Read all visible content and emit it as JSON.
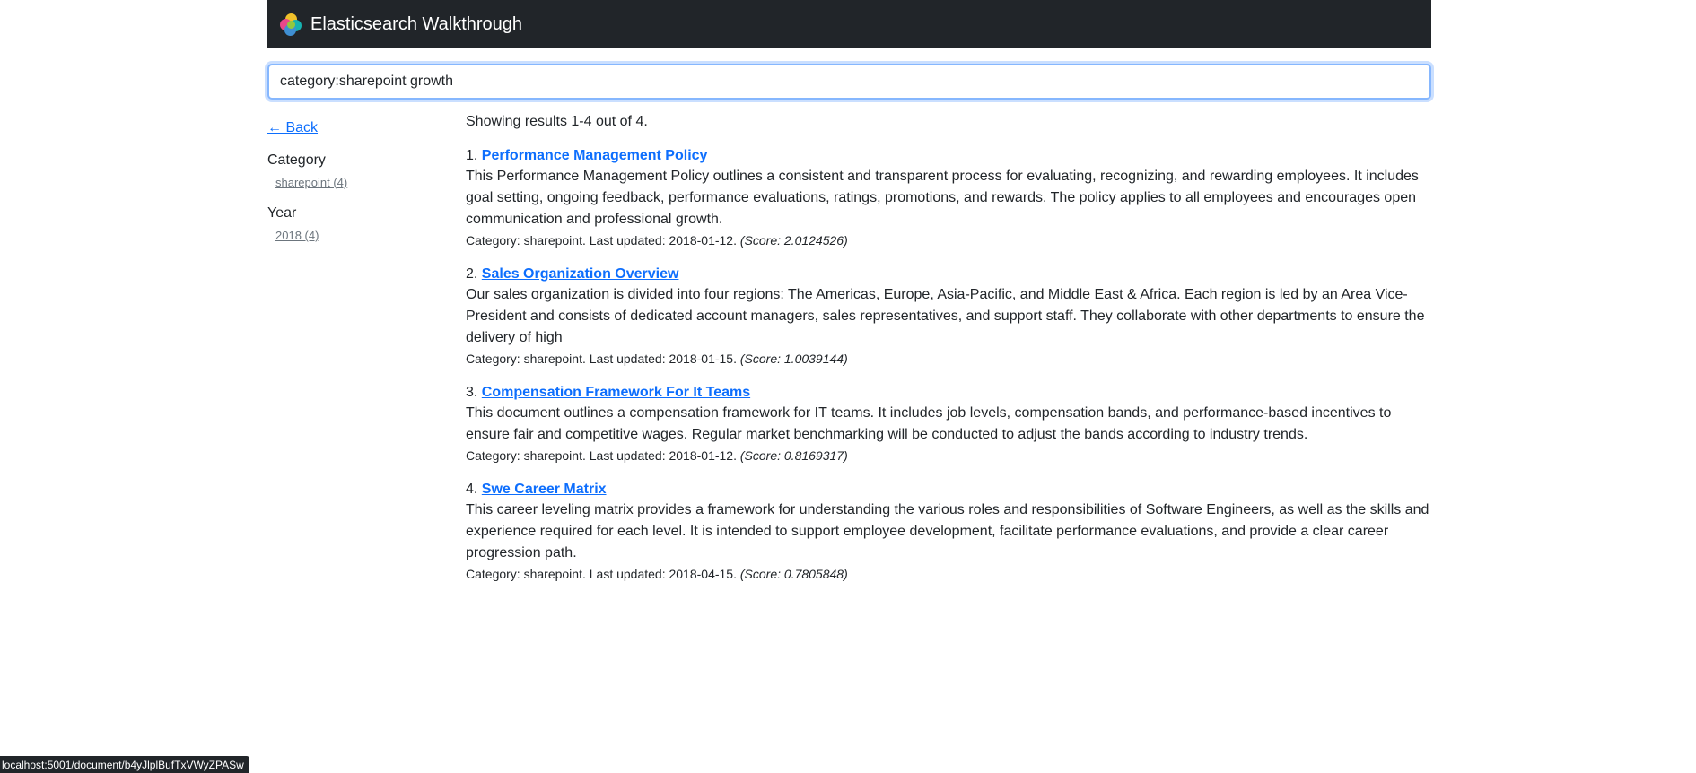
{
  "app": {
    "brand": "Elasticsearch Walkthrough"
  },
  "search": {
    "value": "category:sharepoint growth"
  },
  "sidebar": {
    "back_label": "← Back",
    "facets": [
      {
        "title": "Category",
        "items": [
          {
            "label": "sharepoint (4)"
          }
        ]
      },
      {
        "title": "Year",
        "items": [
          {
            "label": "2018 (4)"
          }
        ]
      }
    ]
  },
  "results": {
    "summary": "Showing results 1-4 out of 4.",
    "items": [
      {
        "number": "1.",
        "title": "Performance Management Policy",
        "description": "This Performance Management Policy outlines a consistent and transparent process for evaluating, recognizing, and rewarding employees. It includes goal setting, ongoing feedback, performance evaluations, ratings, promotions, and rewards. The policy applies to all employees and encourages open communication and professional growth.",
        "meta": "Category: sharepoint. Last updated: 2018-01-12.",
        "score": "(Score: 2.0124526)"
      },
      {
        "number": "2.",
        "title": "Sales Organization Overview",
        "description": "Our sales organization is divided into four regions: The Americas, Europe, Asia-Pacific, and Middle East & Africa. Each region is led by an Area Vice-President and consists of dedicated account managers, sales representatives, and support staff. They collaborate with other departments to ensure the delivery of high",
        "meta": "Category: sharepoint. Last updated: 2018-01-15.",
        "score": "(Score: 1.0039144)"
      },
      {
        "number": "3.",
        "title": "Compensation Framework For It Teams",
        "description": "This document outlines a compensation framework for IT teams. It includes job levels, compensation bands, and performance-based incentives to ensure fair and competitive wages. Regular market benchmarking will be conducted to adjust the bands according to industry trends.",
        "meta": "Category: sharepoint. Last updated: 2018-01-12.",
        "score": "(Score: 0.8169317)"
      },
      {
        "number": "4.",
        "title": "Swe Career Matrix",
        "description": "This career leveling matrix provides a framework for understanding the various roles and responsibilities of Software Engineers, as well as the skills and experience required for each level. It is intended to support employee development, facilitate performance evaluations, and provide a clear career progression path.",
        "meta": "Category: sharepoint. Last updated: 2018-04-15.",
        "score": "(Score: 0.7805848)"
      }
    ]
  },
  "status_bar": {
    "url": "localhost:5001/document/b4yJlplBufTxVWyZPASw"
  }
}
